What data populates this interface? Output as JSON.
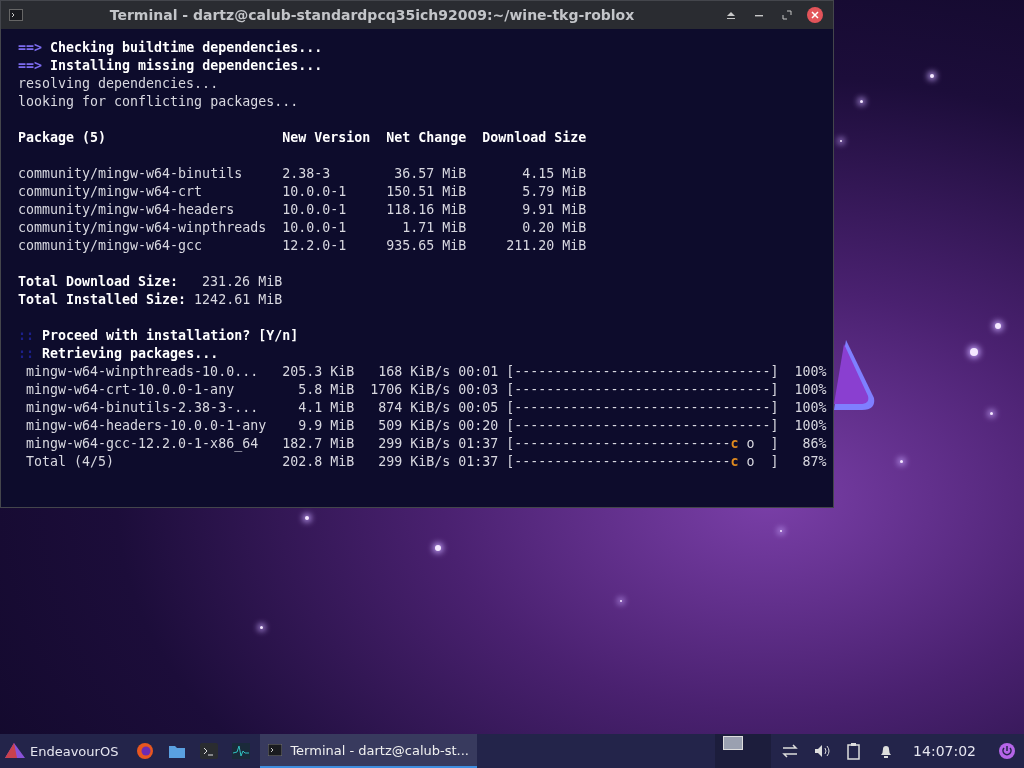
{
  "window": {
    "title": "Terminal - dartz@calub-standardpcq35ich92009:~/wine-tkg-roblox"
  },
  "terminal": {
    "steps_top": [
      {
        "prompt": "==>",
        "color": "#7c6cf0",
        "text": "Checking buildtime dependencies..."
      },
      {
        "prompt": "==>",
        "color": "#7c6cf0",
        "text": "Installing missing dependencies..."
      }
    ],
    "messages": [
      "resolving dependencies...",
      "looking for conflicting packages..."
    ],
    "package_table": {
      "columns": [
        "Package (5)",
        "New Version",
        "Net Change",
        "Download Size"
      ],
      "rows": [
        [
          "community/mingw-w64-binutils",
          "2.38-3",
          "36.57 MiB",
          "4.15 MiB"
        ],
        [
          "community/mingw-w64-crt",
          "10.0.0-1",
          "150.51 MiB",
          "5.79 MiB"
        ],
        [
          "community/mingw-w64-headers",
          "10.0.0-1",
          "118.16 MiB",
          "9.91 MiB"
        ],
        [
          "community/mingw-w64-winpthreads",
          "10.0.0-1",
          "1.71 MiB",
          "0.20 MiB"
        ],
        [
          "community/mingw-w64-gcc",
          "12.2.0-1",
          "935.65 MiB",
          "211.20 MiB"
        ]
      ]
    },
    "totals": [
      {
        "label": "Total Download Size:",
        "value": "231.26 MiB"
      },
      {
        "label": "Total Installed Size:",
        "value": "1242.61 MiB"
      }
    ],
    "steps_bottom": [
      {
        "prompt": "::",
        "color": "#1c1f8a",
        "text": "Proceed with installation? [Y/n]"
      },
      {
        "prompt": "::",
        "color": "#1c1f8a",
        "text": "Retrieving packages..."
      }
    ],
    "downloads": [
      {
        "name": "mingw-w64-winpthreads-10.0...",
        "size": "205.3 KiB",
        "speed": "168 KiB/s",
        "time": "00:01",
        "bar": "[--------------------------------]",
        "percent": "100%"
      },
      {
        "name": "mingw-w64-crt-10.0.0-1-any",
        "size": "5.8 MiB",
        "speed": "1706 KiB/s",
        "time": "00:03",
        "bar": "[--------------------------------]",
        "percent": "100%"
      },
      {
        "name": "mingw-w64-binutils-2.38-3-...",
        "size": "4.1 MiB",
        "speed": "874 KiB/s",
        "time": "00:05",
        "bar": "[--------------------------------]",
        "percent": "100%"
      },
      {
        "name": "mingw-w64-headers-10.0.0-1-any",
        "size": "9.9 MiB",
        "speed": "509 KiB/s",
        "time": "00:20",
        "bar": "[--------------------------------]",
        "percent": "100%"
      },
      {
        "name": "mingw-w64-gcc-12.2.0-1-x86_64",
        "size": "182.7 MiB",
        "speed": "299 KiB/s",
        "time": "01:37",
        "bar": "[---------------------------",
        "marker": "c",
        "tail": " o  ]",
        "percent": "86%"
      },
      {
        "name": "Total (4/5)",
        "size": "202.8 MiB",
        "speed": "299 KiB/s",
        "time": "01:37",
        "bar": "[---------------------------",
        "marker": "c",
        "tail": " o  ]",
        "percent": "87%"
      }
    ]
  },
  "taskbar": {
    "menu_label": "EndeavourOS",
    "tasks": [
      {
        "label": "Terminal - dartz@calub-st...",
        "selected": true
      }
    ],
    "clock": "14:07:02"
  }
}
